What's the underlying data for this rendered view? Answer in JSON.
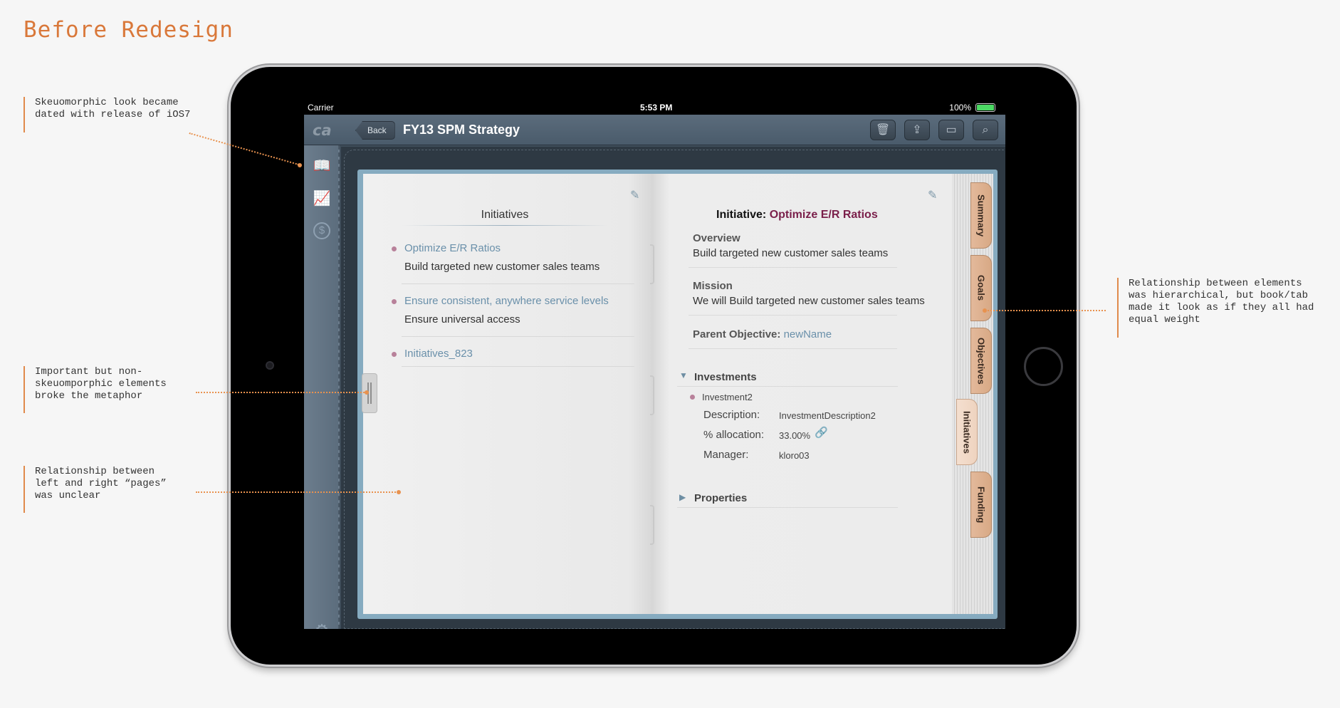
{
  "page": {
    "title": "Before Redesign"
  },
  "annotations": [
    {
      "text": "Skeuomorphic look became\ndated with release of iOS7"
    },
    {
      "text": "Important but non-\nskeuomporphic elements\nbroke the metaphor"
    },
    {
      "text": "Relationship between\nleft and right “pages”\nwas unclear"
    },
    {
      "text": "Relationship between elements\nwas hierarchical, but book/tab\nmade it look as if they all had\nequal weight"
    }
  ],
  "status_bar": {
    "carrier": "Carrier",
    "time": "5:53 PM",
    "battery": "100%"
  },
  "nav": {
    "logo": "ca",
    "back": "Back",
    "title": "FY13 SPM Strategy"
  },
  "toolbar": [
    {
      "icon": "trash-icon"
    },
    {
      "icon": "share-icon"
    },
    {
      "icon": "comment-icon"
    },
    {
      "icon": "search-icon"
    }
  ],
  "sidebar": [
    {
      "icon": "book-icon"
    },
    {
      "icon": "chart-icon"
    },
    {
      "icon": "dollar-icon"
    },
    {
      "icon": "gear-icon"
    }
  ],
  "left_page": {
    "heading": "Initiatives",
    "items": [
      {
        "title": "Optimize E/R Ratios",
        "subtitle": "Build targeted new customer sales teams"
      },
      {
        "title": "Ensure consistent, anywhere service levels",
        "subtitle": "Ensure universal access"
      },
      {
        "title": "Initiatives_823",
        "subtitle": ""
      }
    ]
  },
  "right_page": {
    "heading_prefix": "Initiative:",
    "heading_name": "Optimize E/R Ratios",
    "overview_label": "Overview",
    "overview_text": "Build targeted new customer sales teams",
    "mission_label": "Mission",
    "mission_text": "We will Build targeted new customer sales teams",
    "parent_label": "Parent Objective:",
    "parent_value": "newName",
    "investments_label": "Investments",
    "investment": {
      "name": "Investment2",
      "description_label": "Description:",
      "description_value": "InvestmentDescription2",
      "allocation_label": "% allocation:",
      "allocation_value": "33.00%",
      "manager_label": "Manager:",
      "manager_value": "kloro03"
    },
    "properties_label": "Properties"
  },
  "tabs": [
    {
      "label": "Summary",
      "active": false
    },
    {
      "label": "Goals",
      "active": false
    },
    {
      "label": "Objectives",
      "active": false
    },
    {
      "label": "Initiatives",
      "active": true
    },
    {
      "label": "Funding",
      "active": false
    }
  ],
  "colors": {
    "annotation": "#d9783a",
    "accent_link": "#6a90aa",
    "initiative_name": "#7a1f4a",
    "tab": "#d8a985"
  }
}
